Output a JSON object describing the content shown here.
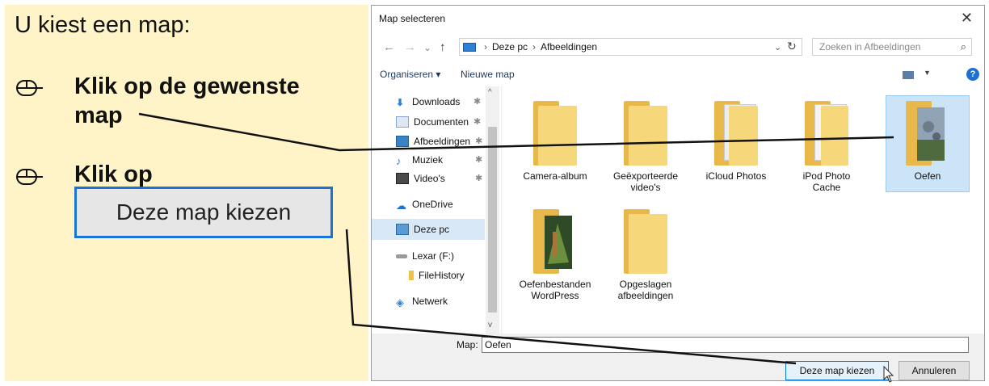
{
  "instructions": {
    "intro": "U kiest een map:",
    "step1_line1": "Klik op de gewenste",
    "step1_line2": "map",
    "step2": "Klik op",
    "big_button": "Deze map kiezen"
  },
  "dialog": {
    "title": "Map selecteren",
    "close": "✕",
    "nav": {
      "back": "←",
      "forward": "→",
      "recent": "⌄",
      "up": "↑"
    },
    "breadcrumb": [
      "Deze pc",
      "Afbeeldingen"
    ],
    "breadcrumb_sep": "›",
    "search_placeholder": "Zoeken in Afbeeldingen",
    "toolbar": {
      "organize": "Organiseren ▾",
      "new_folder": "Nieuwe map",
      "help": "?"
    },
    "sidebar": {
      "downloads": "Downloads",
      "documents": "Documenten",
      "pictures": "Afbeeldingen",
      "music": "Muziek",
      "videos": "Video's",
      "onedrive": "OneDrive",
      "thispc": "Deze pc",
      "lexar": "Lexar (F:)",
      "filehistory": "FileHistory",
      "network": "Netwerk"
    },
    "folders": {
      "camera": "Camera-album",
      "exported": "Geëxporteerde video's",
      "icloud": "iCloud Photos",
      "ipod": "iPod Photo Cache",
      "oefen": "Oefen",
      "oefenbestanden": "Oefenbestanden WordPress",
      "opgeslagen": "Opgeslagen afbeeldingen"
    },
    "folder_label": "Map:",
    "folder_value": "Oefen",
    "choose_button": "Deze map kiezen",
    "cancel_button": "Annuleren"
  },
  "colors": {
    "panel": "#fff4c8",
    "accent": "#0078d7",
    "folder": "#f6d77a",
    "selection": "#cce4f7"
  }
}
